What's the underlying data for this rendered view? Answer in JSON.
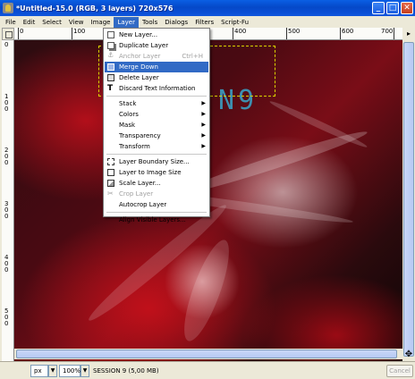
{
  "window": {
    "title": "*Untitled-15.0 (RGB, 3 layers) 720x576",
    "minimize_glyph": "_",
    "maximize_glyph": "□",
    "close_glyph": "✕"
  },
  "menubar": {
    "items": [
      "File",
      "Edit",
      "Select",
      "View",
      "Image",
      "Layer",
      "Tools",
      "Dialogs",
      "Filters",
      "Script-Fu"
    ],
    "active": "Layer"
  },
  "ruler": {
    "h_labels": [
      "0",
      "100",
      "200",
      "300",
      "400",
      "500",
      "600",
      "700"
    ],
    "v_labels": [
      "0",
      "1\n0\n0",
      "2\n0\n0",
      "3\n0\n0",
      "4\n0\n0",
      "5\n0\n0"
    ]
  },
  "canvas": {
    "text": "N9"
  },
  "layer_menu": {
    "items": [
      {
        "label": "New Layer...",
        "icon": "new-layer-icon",
        "enabled": true
      },
      {
        "label": "Duplicate Layer",
        "icon": "duplicate-layer-icon",
        "enabled": true
      },
      {
        "label": "Anchor Layer",
        "shortcut": "Ctrl+H",
        "icon": "anchor-icon",
        "enabled": false
      },
      {
        "label": "Merge Down",
        "icon": "merge-down-icon",
        "enabled": true,
        "highlighted": true
      },
      {
        "label": "Delete Layer",
        "icon": "delete-layer-icon",
        "enabled": true
      },
      {
        "label": "Discard Text Information",
        "icon": "text-icon",
        "enabled": true
      },
      {
        "separator": true
      },
      {
        "label": "Stack",
        "submenu": true,
        "enabled": true
      },
      {
        "label": "Colors",
        "submenu": true,
        "enabled": true
      },
      {
        "label": "Mask",
        "submenu": true,
        "enabled": true
      },
      {
        "label": "Transparency",
        "submenu": true,
        "enabled": true
      },
      {
        "label": "Transform",
        "submenu": true,
        "enabled": true
      },
      {
        "separator": true
      },
      {
        "label": "Layer Boundary Size...",
        "icon": "boundary-size-icon",
        "enabled": true
      },
      {
        "label": "Layer to Image Size",
        "icon": "layer-to-image-icon",
        "enabled": true
      },
      {
        "label": "Scale Layer...",
        "icon": "scale-layer-icon",
        "enabled": true
      },
      {
        "label": "Crop Layer",
        "icon": "crop-icon",
        "enabled": false
      },
      {
        "label": "Autocrop Layer",
        "enabled": true
      },
      {
        "separator": true
      },
      {
        "label": "Align Visible Layers...",
        "enabled": true
      }
    ]
  },
  "statusbar": {
    "unit": "px",
    "zoom": "100%",
    "message": "SESSION 9 (5,00 MB)",
    "cancel": "Cancel",
    "dropdown_glyph": "▼"
  },
  "colors": {
    "titlebar": "#0548c8",
    "menu_highlight": "#316ac5",
    "selection": "#d9d200"
  }
}
